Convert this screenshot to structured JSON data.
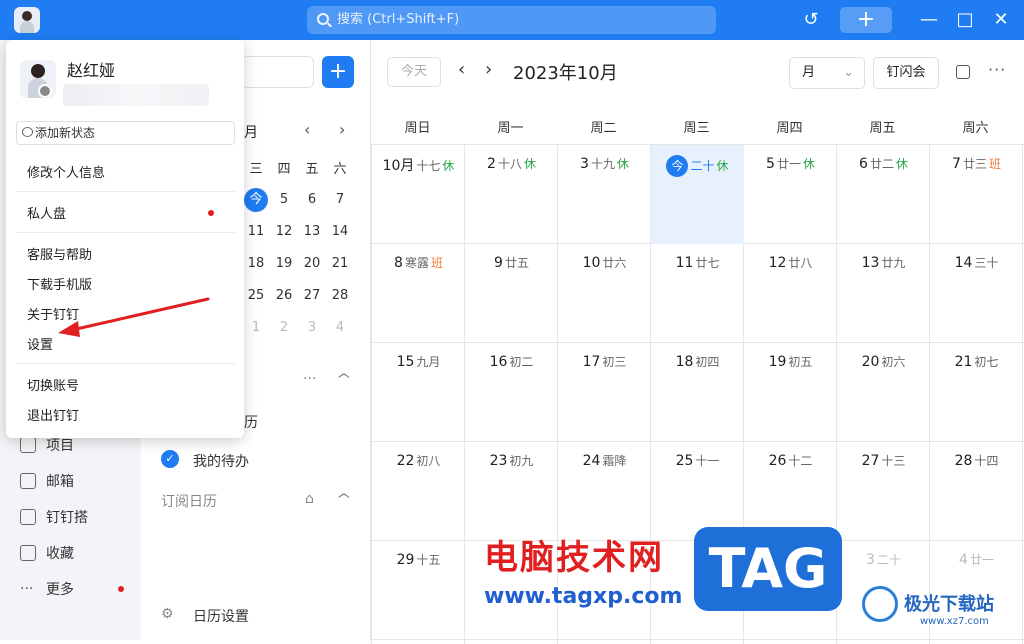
{
  "titlebar": {
    "search_placeholder": "搜索 (Ctrl+Shift+F)",
    "plus_label": "+",
    "min_label": "—",
    "max_label": "□",
    "close_label": "✕",
    "history_label": "↺"
  },
  "nav": {
    "items": [
      {
        "label": "项目"
      },
      {
        "label": "邮箱"
      },
      {
        "label": "钉钉搭"
      },
      {
        "label": "收藏"
      },
      {
        "label": "更多"
      }
    ]
  },
  "mid": {
    "add_label": "+",
    "mini_month_suffix": "月",
    "mini_weekdays": [
      "三",
      "四",
      "五",
      "六"
    ],
    "mini_rows": [
      [
        "今",
        "5",
        "6",
        "7"
      ],
      [
        "11",
        "12",
        "13",
        "14"
      ],
      [
        "18",
        "19",
        "20",
        "21"
      ],
      [
        "25",
        "26",
        "27",
        "28"
      ],
      [
        "1",
        "2",
        "3",
        "4"
      ]
    ],
    "section_partial": "历",
    "todo_label": "我的待办",
    "subscribed_label": "订阅日历",
    "settings_label": "日历设置",
    "more_label": "···",
    "collapse_label": "^"
  },
  "calendar": {
    "today_btn": "今天",
    "title": "2023年10月",
    "view": "月",
    "flash_meeting": "钉闪会",
    "weekdays": [
      "周日",
      "周一",
      "周二",
      "周三",
      "周四",
      "周五",
      "周六"
    ],
    "weeks": [
      [
        {
          "num": "10月",
          "lunar": "十七",
          "tag": "休",
          "tag_type": "rest"
        },
        {
          "num": "2",
          "lunar": "十八",
          "tag": "休",
          "tag_type": "rest"
        },
        {
          "num": "3",
          "lunar": "十九",
          "tag": "休",
          "tag_type": "rest"
        },
        {
          "num": "今",
          "lunar": "二十",
          "tag": "休",
          "tag_type": "rest",
          "today": true
        },
        {
          "num": "5",
          "lunar": "廿一",
          "tag": "休",
          "tag_type": "rest"
        },
        {
          "num": "6",
          "lunar": "廿二",
          "tag": "休",
          "tag_type": "rest"
        },
        {
          "num": "7",
          "lunar": "廿三",
          "tag": "班",
          "tag_type": "work"
        }
      ],
      [
        {
          "num": "8",
          "lunar": "寒露",
          "tag": "班",
          "tag_type": "work"
        },
        {
          "num": "9",
          "lunar": "廿五"
        },
        {
          "num": "10",
          "lunar": "廿六"
        },
        {
          "num": "11",
          "lunar": "廿七"
        },
        {
          "num": "12",
          "lunar": "廿八"
        },
        {
          "num": "13",
          "lunar": "廿九"
        },
        {
          "num": "14",
          "lunar": "三十"
        }
      ],
      [
        {
          "num": "15",
          "lunar": "九月"
        },
        {
          "num": "16",
          "lunar": "初二"
        },
        {
          "num": "17",
          "lunar": "初三"
        },
        {
          "num": "18",
          "lunar": "初四"
        },
        {
          "num": "19",
          "lunar": "初五"
        },
        {
          "num": "20",
          "lunar": "初六"
        },
        {
          "num": "21",
          "lunar": "初七"
        }
      ],
      [
        {
          "num": "22",
          "lunar": "初八"
        },
        {
          "num": "23",
          "lunar": "初九"
        },
        {
          "num": "24",
          "lunar": "霜降"
        },
        {
          "num": "25",
          "lunar": "十一"
        },
        {
          "num": "26",
          "lunar": "十二"
        },
        {
          "num": "27",
          "lunar": "十三"
        },
        {
          "num": "28",
          "lunar": "十四"
        }
      ],
      [
        {
          "num": "29",
          "lunar": "十五"
        },
        {
          "num": "",
          "lunar": ""
        },
        {
          "num": "",
          "lunar": ""
        },
        {
          "num": "",
          "lunar": ""
        },
        {
          "num": "",
          "lunar": ""
        },
        {
          "num": "3",
          "lunar": "二十",
          "faded": true
        },
        {
          "num": "4",
          "lunar": "廿一",
          "faded": true
        }
      ]
    ]
  },
  "popup": {
    "name": "赵红娅",
    "status_btn": "添加新状态",
    "items": [
      {
        "label": "修改个人信息"
      },
      {
        "label": "私人盘"
      },
      {
        "label": "客服与帮助"
      },
      {
        "label": "下载手机版"
      },
      {
        "label": "关于钉钉"
      },
      {
        "label": "设置"
      },
      {
        "label": "切换账号"
      },
      {
        "label": "退出钉钉"
      }
    ]
  },
  "watermark": {
    "cn": "电脑技术网",
    "url": "www.tagxp.com",
    "tag": "TAG",
    "xz_name": "极光下载站",
    "xz_url": "www.xz7.com"
  },
  "colors": {
    "brand": "#1f7cf3",
    "rest": "#26a644",
    "work": "#f07a3a",
    "annotation_arrow": "#e02020"
  }
}
